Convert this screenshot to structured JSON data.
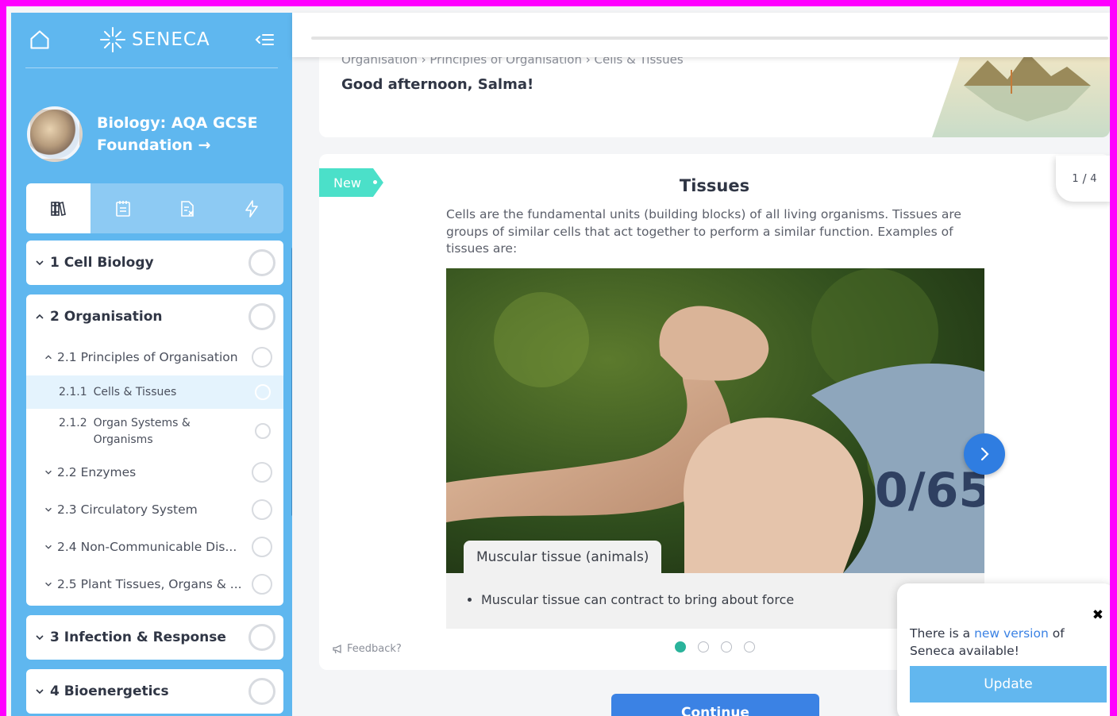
{
  "sidebar": {
    "logo_text": "SENECA",
    "course_title_line1": "Biology: AQA GCSE",
    "course_title_line2": "Foundation →",
    "sections": [
      {
        "num": "1",
        "title": "Cell Biology",
        "expanded": false
      },
      {
        "num": "2",
        "title": "Organisation",
        "expanded": true,
        "subsections": [
          {
            "num": "2.1",
            "title": "Principles of Organisation",
            "expanded": true,
            "items": [
              {
                "num": "2.1.1",
                "title": "Cells & Tissues",
                "active": true
              },
              {
                "num": "2.1.2",
                "title_line1": "Organ Systems &",
                "title_line2": "Organisms",
                "active": false
              }
            ]
          },
          {
            "num": "2.2",
            "title": "Enzymes"
          },
          {
            "num": "2.3",
            "title": "Circulatory System"
          },
          {
            "num": "2.4",
            "title": "Non-Communicable Dis..."
          },
          {
            "num": "2.5",
            "title": "Plant Tissues, Organs & ..."
          }
        ]
      },
      {
        "num": "3",
        "title": "Infection & Response",
        "expanded": false
      },
      {
        "num": "4",
        "title": "Bioenergetics",
        "expanded": false
      }
    ]
  },
  "header": {
    "breadcrumb": "Organisation › Principles of Organisation › Cells & Tissues",
    "greeting": "Good afternoon, Salma!"
  },
  "lesson": {
    "tag": "New",
    "page_current": "1",
    "page_total": "4",
    "title": "Tissues",
    "text": "Cells are the fundamental units (building blocks) of all living organisms. Tissues are groups of similar cells that act together to perform a similar function. Examples of tissues are:",
    "image_caption": "Muscular tissue (animals)",
    "bullet": "Muscular tissue can contract to bring about force",
    "feedback": "Feedback?",
    "continue": "Continue"
  },
  "toast": {
    "text_before": "There is a ",
    "link": "new version",
    "text_after": " of Seneca available!",
    "button": "Update",
    "close": "✖"
  },
  "colors": {
    "sidebar": "#5fb7ef",
    "accent_teal": "#4be0c9",
    "primary_blue": "#3b82e4",
    "frame_border": "#ff00ff"
  }
}
